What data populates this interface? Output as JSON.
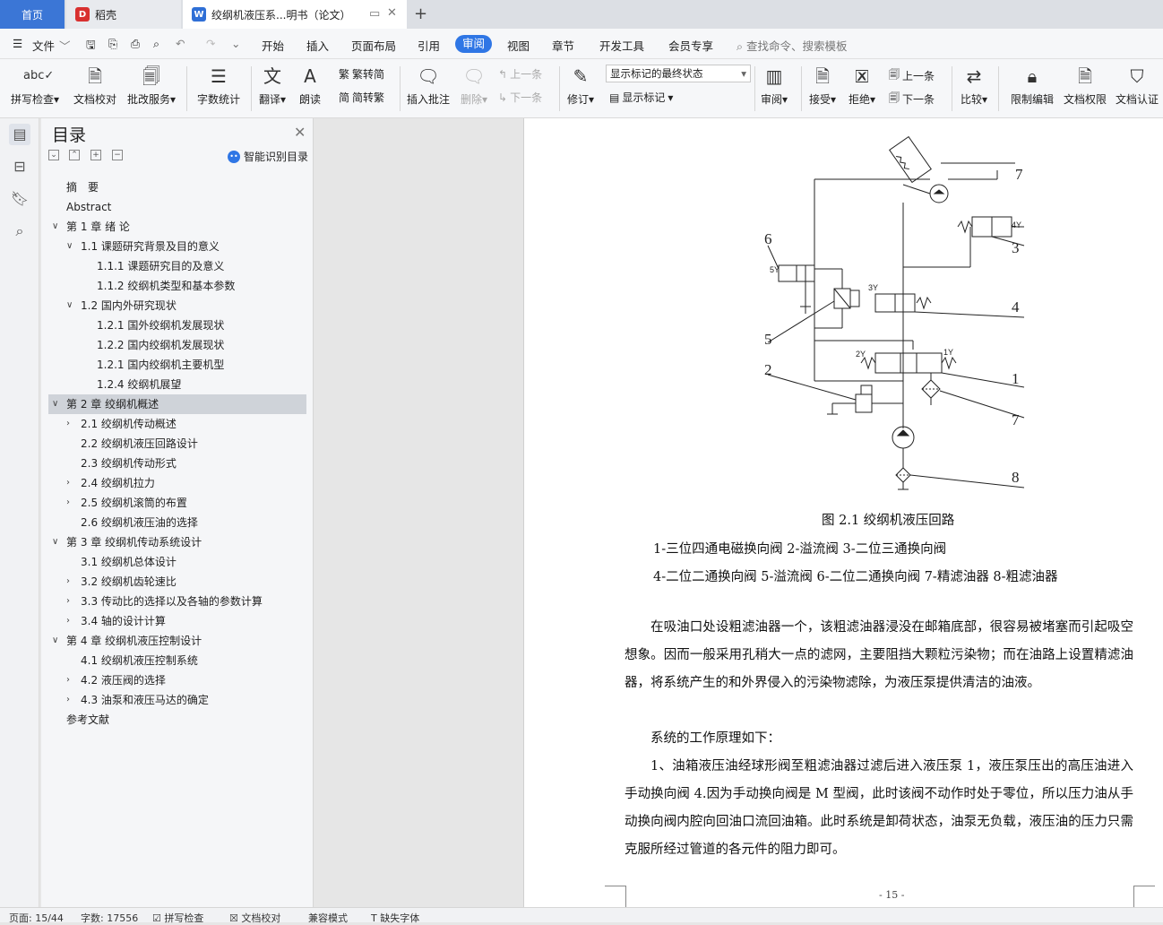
{
  "titlebar": {
    "home_tab": "首页",
    "daoke_tab": "稻壳",
    "doc_tab": "绞纲机液压系...明书（论文）",
    "daoke_icon": "daoke-icon",
    "doc_icon": "writer-doc-icon"
  },
  "menu": {
    "file": "文件",
    "items": [
      "开始",
      "插入",
      "页面布局",
      "引用",
      "审阅",
      "视图",
      "章节",
      "开发工具",
      "会员专享"
    ],
    "active": "审阅",
    "search": "查找命令、搜索模板"
  },
  "ribbon": {
    "spell": "拼写检查",
    "doccheck": "文档校对",
    "review_service": "批改服务",
    "word_count": "字数统计",
    "translate": "翻译",
    "read": "朗读",
    "trad2simp": "繁转简",
    "simp2trad": "简转繁",
    "insert_comment": "插入批注",
    "delete": "删除",
    "prev_comment": "上一条",
    "next_comment": "下一条",
    "revise": "修订",
    "display_state": "显示标记的最终状态",
    "show_marks": "显示标记",
    "review_pane": "审阅",
    "accept": "接受",
    "reject": "拒绝",
    "prev_change": "上一条",
    "next_change": "下一条",
    "compare": "比较",
    "restrict": "限制编辑",
    "doc_rights": "文档权限",
    "doc_cert": "文档认证"
  },
  "toc": {
    "title": "目录",
    "smart": "智能识别目录",
    "items": [
      {
        "text": "摘　要",
        "level": 0,
        "arrow": ""
      },
      {
        "text": "Abstract",
        "level": 0,
        "arrow": ""
      },
      {
        "text": "第 1 章  绪  论",
        "level": 0,
        "arrow": "v"
      },
      {
        "text": "1.1  课题研究背景及目的意义",
        "level": 1,
        "arrow": "v"
      },
      {
        "text": "1.1.1  课题研究目的及意义",
        "level": 2,
        "arrow": ""
      },
      {
        "text": "1.1.2  绞纲机类型和基本参数",
        "level": 2,
        "arrow": ""
      },
      {
        "text": "1.2  国内外研究现状",
        "level": 1,
        "arrow": "v"
      },
      {
        "text": "1.2.1  国外绞纲机发展现状",
        "level": 2,
        "arrow": ""
      },
      {
        "text": "1.2.2  国内绞纲机发展现状",
        "level": 2,
        "arrow": ""
      },
      {
        "text": "1.2.1  国内绞纲机主要机型",
        "level": 2,
        "arrow": ""
      },
      {
        "text": "1.2.4  绞纲机展望",
        "level": 2,
        "arrow": ""
      },
      {
        "text": "第 2 章  绞纲机概述",
        "level": 0,
        "arrow": "v",
        "selected": true
      },
      {
        "text": "2.1  绞纲机传动概述",
        "level": 1,
        "arrow": ">"
      },
      {
        "text": "2.2  绞纲机液压回路设计",
        "level": 1,
        "arrow": ""
      },
      {
        "text": "2.3  绞纲机传动形式",
        "level": 1,
        "arrow": ""
      },
      {
        "text": "2.4  绞纲机拉力",
        "level": 1,
        "arrow": ">"
      },
      {
        "text": "2.5  绞纲机滚筒的布置",
        "level": 1,
        "arrow": ">"
      },
      {
        "text": "2.6  绞纲机液压油的选择",
        "level": 1,
        "arrow": ""
      },
      {
        "text": "第 3 章  绞纲机传动系统设计",
        "level": 0,
        "arrow": "v"
      },
      {
        "text": "3.1  绞纲机总体设计",
        "level": 1,
        "arrow": ""
      },
      {
        "text": "3.2  绞纲机齿轮速比",
        "level": 1,
        "arrow": ">"
      },
      {
        "text": "3.3  传动比的选择以及各轴的参数计算",
        "level": 1,
        "arrow": ">"
      },
      {
        "text": "3.4  轴的设计计算",
        "level": 1,
        "arrow": ">"
      },
      {
        "text": "第 4 章  绞纲机液压控制设计",
        "level": 0,
        "arrow": "v"
      },
      {
        "text": "4.1  绞纲机液压控制系统",
        "level": 1,
        "arrow": ""
      },
      {
        "text": "4.2  液压阀的选择",
        "level": 1,
        "arrow": ">"
      },
      {
        "text": "4.3  油泵和液压马达的确定",
        "level": 1,
        "arrow": ">"
      },
      {
        "text": "参考文献",
        "level": 0,
        "arrow": ""
      }
    ]
  },
  "diagram": {
    "labels": [
      "7",
      "6",
      "3",
      "4",
      "5",
      "2",
      "1",
      "7",
      "8"
    ],
    "small_labels": [
      "4Y",
      "5Y",
      "3Y",
      "2Y",
      "1Y"
    ]
  },
  "document": {
    "figure_caption": "图 2.1  绞纲机液压回路",
    "legend1": "1-三位四通电磁换向阀  2-溢流阀  3-二位三通换向阀",
    "legend2": "4-二位二通换向阀  5-溢流阀    6-二位二通换向阀  7-精滤油器  8-粗滤油器",
    "para1": "在吸油口处设粗滤油器一个，该粗滤油器浸没在邮箱底部，很容易被堵塞而引起吸空想象。因而一般采用孔稍大一点的滤网，主要阻挡大颗粒污染物；而在油路上设置精滤油器，将系统产生的和外界侵入的污染物滤除，为液压泵提供清洁的油液。",
    "para2": "系统的工作原理如下：",
    "para3": "1、油箱液压油经球形阀至粗滤油器过滤后进入液压泵 1，液压泵压出的高压油进入手动换向阀 4.因为手动换向阀是 M 型阀，此时该阀不动作时处于零位，所以压力油从手动换向阀内腔向回油口流回油箱。此时系统是卸荷状态，油泵无负载，液压油的压力只需克服所经过管道的各元件的阻力即可。",
    "page_number": "- 15 -"
  },
  "status": {
    "page": "页面: 15/44",
    "words": "字数: 17556",
    "spell": "拼写检查",
    "doccheck": "文档校对",
    "compat": "兼容模式",
    "missing_font": "缺失字体"
  }
}
